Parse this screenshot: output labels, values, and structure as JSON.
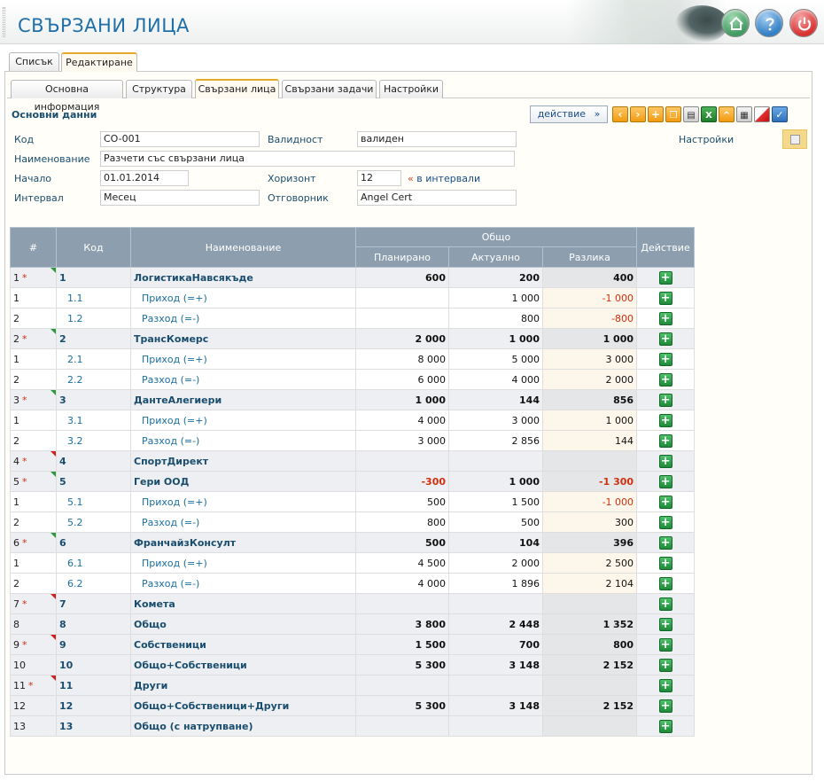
{
  "header": {
    "title": "СВЪРЗАНИ ЛИЦА"
  },
  "tabs_main": [
    {
      "label": "Списък"
    },
    {
      "label": "Редактиране"
    }
  ],
  "tabs_sub": [
    {
      "label": "Основна информация"
    },
    {
      "label": "Структура"
    },
    {
      "label": "Свързани лица"
    },
    {
      "label": "Свързани задачи"
    },
    {
      "label": "Настройки"
    }
  ],
  "section": {
    "title": "Основни данни",
    "action_label": "действие",
    "action_arrow": "»"
  },
  "toolbar_icons": [
    "prev-icon",
    "next-icon",
    "add-icon",
    "copy-icon",
    "print-icon",
    "excel-icon",
    "collapse-icon",
    "calculator-icon",
    "clear-icon",
    "save-icon"
  ],
  "form": {
    "code_label": "Код",
    "code_value": "CO-001",
    "validity_label": "Валидност",
    "validity_value": "валиден",
    "name_label": "Наименование",
    "name_value": "Разчети със свързани лица",
    "start_label": "Начало",
    "start_value": "01.01.2014",
    "horizon_label": "Хоризонт",
    "horizon_value": "12",
    "horizon_note_mark": "«",
    "horizon_note": "в интервали",
    "interval_label": "Интервал",
    "interval_value": "Месец",
    "owner_label": "Отговорник",
    "owner_value": "Angel Cert",
    "settings_label": "Настройки"
  },
  "table": {
    "headers": {
      "idx": "#",
      "code": "Код",
      "name": "Наименование",
      "group": "Общо",
      "planned": "Планирано",
      "actual": "Актуално",
      "diff": "Разлика",
      "action": "Действие"
    },
    "rows": [
      {
        "type": "main",
        "idx": "1",
        "star": "*",
        "tri": "g",
        "code": "1",
        "name": "ЛогистикаНавсякъде",
        "planned": "600",
        "actual": "200",
        "diff": "400"
      },
      {
        "type": "sub",
        "idx": "1",
        "code": "1.1",
        "name": "Приход (=+)",
        "planned": "",
        "actual": "1 000",
        "diff": "-1 000",
        "diff_neg": true
      },
      {
        "type": "sub",
        "idx": "2",
        "code": "1.2",
        "name": "Разход (=-)",
        "planned": "",
        "actual": "800",
        "diff": "-800",
        "diff_neg": true
      },
      {
        "type": "main",
        "idx": "2",
        "star": "*",
        "tri": "g",
        "code": "2",
        "name": "ТрансКомерс",
        "planned": "2 000",
        "actual": "1 000",
        "diff": "1 000"
      },
      {
        "type": "sub",
        "idx": "1",
        "code": "2.1",
        "name": "Приход (=+)",
        "planned": "8 000",
        "actual": "5 000",
        "diff": "3 000"
      },
      {
        "type": "sub",
        "idx": "2",
        "code": "2.2",
        "name": "Разход (=-)",
        "planned": "6 000",
        "actual": "4 000",
        "diff": "2 000"
      },
      {
        "type": "main",
        "idx": "3",
        "star": "*",
        "tri": "g",
        "code": "3",
        "name": "ДантеАлегиери",
        "planned": "1 000",
        "actual": "144",
        "diff": "856"
      },
      {
        "type": "sub",
        "idx": "1",
        "code": "3.1",
        "name": "Приход (=+)",
        "planned": "4 000",
        "actual": "3 000",
        "diff": "1 000"
      },
      {
        "type": "sub",
        "idx": "2",
        "code": "3.2",
        "name": "Разход (=-)",
        "planned": "3 000",
        "actual": "2 856",
        "diff": "144"
      },
      {
        "type": "main",
        "idx": "4",
        "star": "*",
        "tri": "r",
        "code": "4",
        "name": "СпортДирект",
        "planned": "",
        "actual": "",
        "diff": ""
      },
      {
        "type": "main",
        "idx": "5",
        "star": "*",
        "tri": "g",
        "code": "5",
        "name": "Гери ООД",
        "planned": "-300",
        "planned_neg": true,
        "actual": "1 000",
        "diff": "-1 300",
        "diff_neg": true
      },
      {
        "type": "sub",
        "idx": "1",
        "code": "5.1",
        "name": "Приход (=+)",
        "planned": "500",
        "actual": "1 500",
        "diff": "-1 000",
        "diff_neg": true
      },
      {
        "type": "sub",
        "idx": "2",
        "code": "5.2",
        "name": "Разход (=-)",
        "planned": "800",
        "actual": "500",
        "diff": "300"
      },
      {
        "type": "main",
        "idx": "6",
        "star": "*",
        "tri": "g",
        "code": "6",
        "name": "ФранчайзКонсулт",
        "planned": "500",
        "actual": "104",
        "diff": "396"
      },
      {
        "type": "sub",
        "idx": "1",
        "code": "6.1",
        "name": "Приход (=+)",
        "planned": "4 500",
        "actual": "2 000",
        "diff": "2 500"
      },
      {
        "type": "sub",
        "idx": "2",
        "code": "6.2",
        "name": "Разход (=-)",
        "planned": "4 000",
        "actual": "1 896",
        "diff": "2 104"
      },
      {
        "type": "main",
        "idx": "7",
        "star": "*",
        "tri": "r",
        "code": "7",
        "name": "Комета",
        "planned": "",
        "actual": "",
        "diff": ""
      },
      {
        "type": "main",
        "idx": "8",
        "star": "",
        "tri": "",
        "code": "8",
        "name": "Общо",
        "planned": "3 800",
        "actual": "2 448",
        "diff": "1 352"
      },
      {
        "type": "main",
        "idx": "9",
        "star": "*",
        "tri": "r",
        "code": "9",
        "name": "Собственици",
        "planned": "1 500",
        "actual": "700",
        "diff": "800"
      },
      {
        "type": "main",
        "idx": "10",
        "star": "",
        "tri": "",
        "code": "10",
        "name": "Общо+Собственици",
        "planned": "5 300",
        "actual": "3 148",
        "diff": "2 152"
      },
      {
        "type": "main",
        "idx": "11",
        "star": "*",
        "tri": "r",
        "code": "11",
        "name": "Други",
        "planned": "",
        "actual": "",
        "diff": ""
      },
      {
        "type": "main",
        "idx": "12",
        "star": "",
        "tri": "",
        "code": "12",
        "name": "Общо+Собственици+Други",
        "planned": "5 300",
        "actual": "3 148",
        "diff": "2 152"
      },
      {
        "type": "main",
        "idx": "13",
        "star": "",
        "tri": "",
        "code": "13",
        "name": "Общо (с натрупване)",
        "planned": "",
        "actual": "",
        "diff": ""
      }
    ]
  },
  "colors": {
    "accent": "#1f6fa8",
    "header_bg": "#8d9eae",
    "negative": "#d03010",
    "tab_active": "#e3a92a"
  }
}
